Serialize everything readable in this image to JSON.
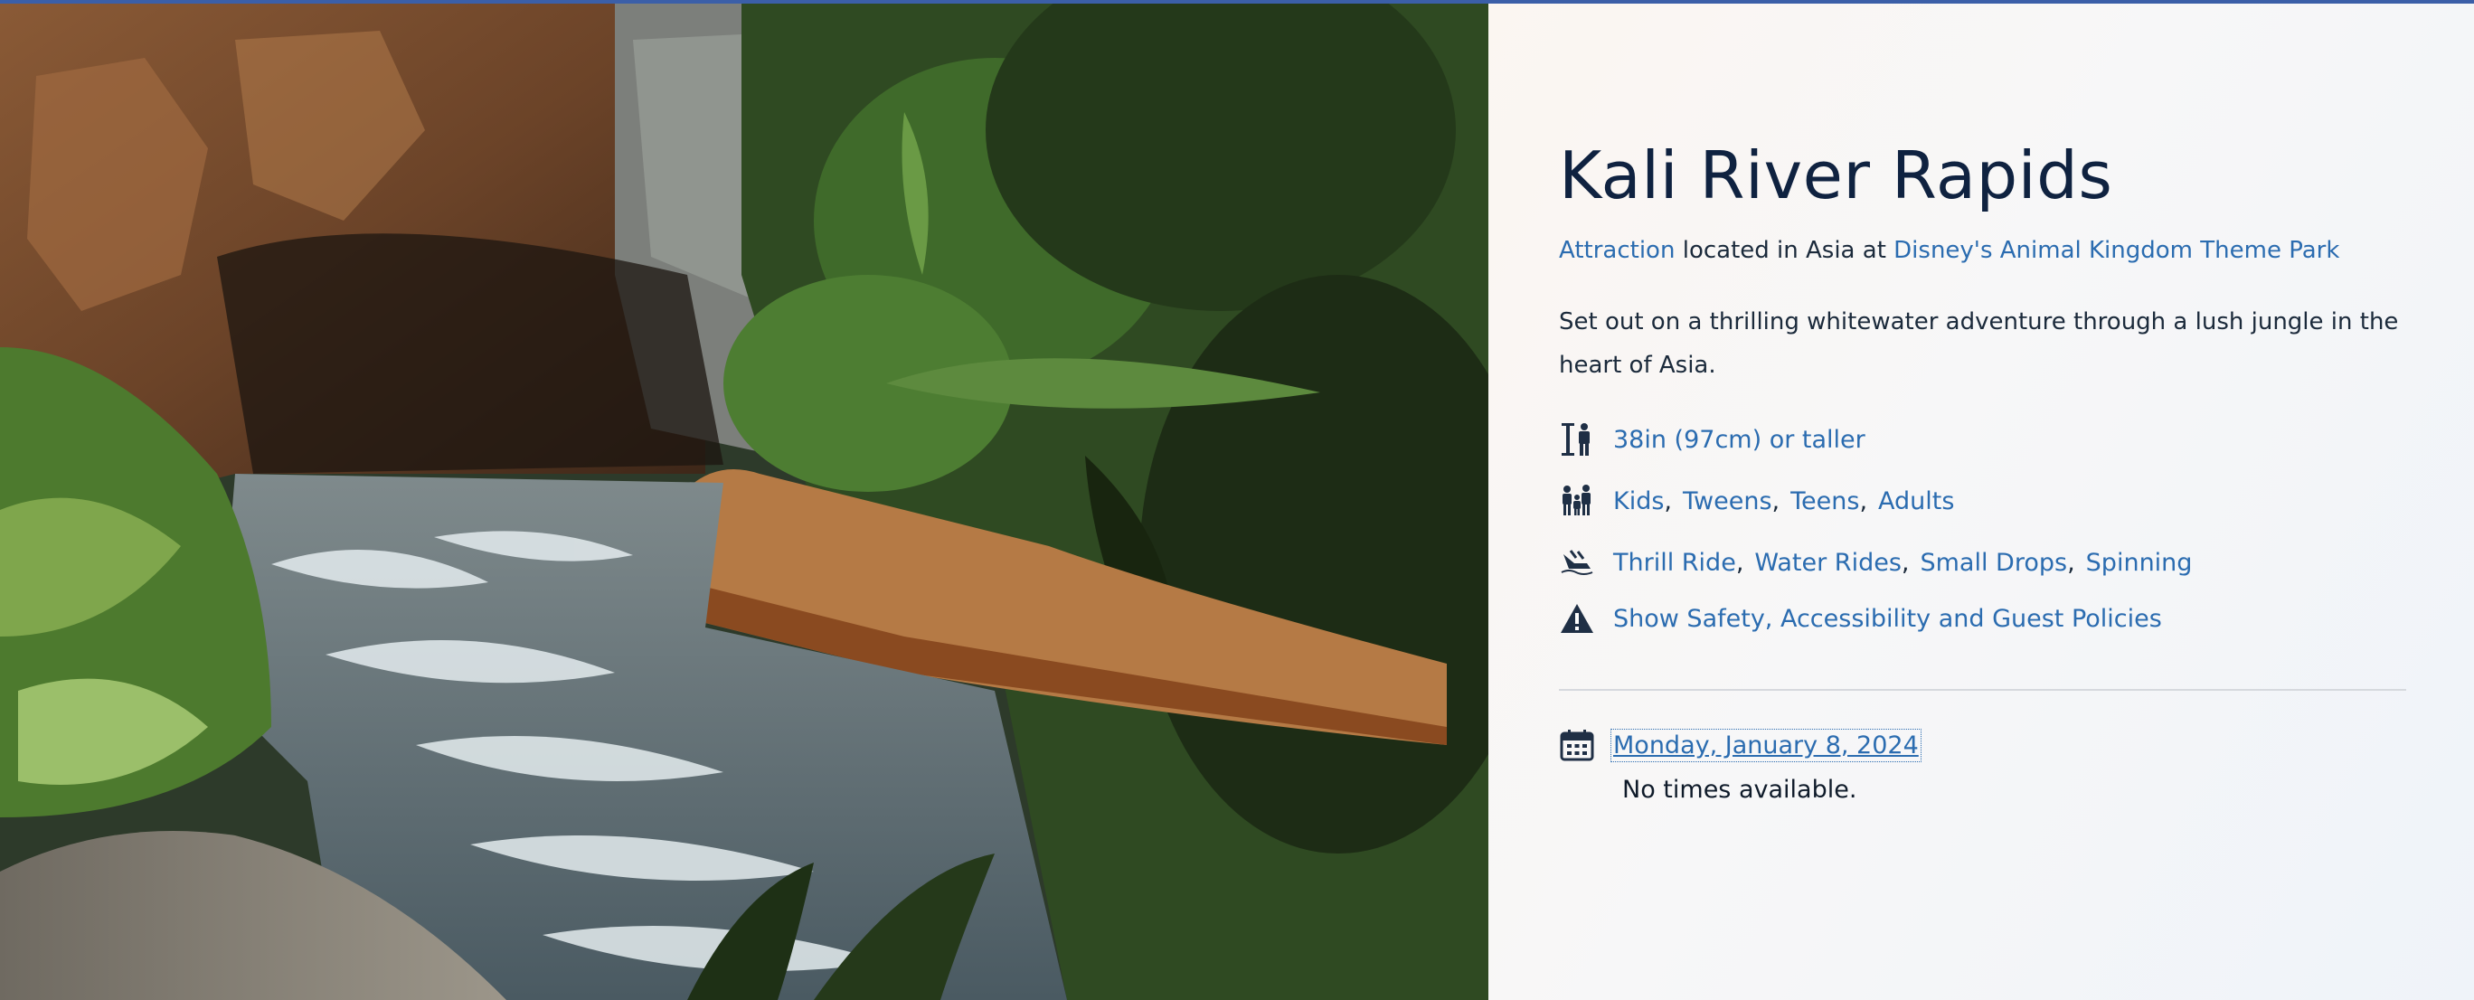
{
  "attraction": {
    "title": "Kali River Rapids",
    "type_link": "Attraction",
    "location_text": "located in Asia at",
    "park_link": "Disney's Animal Kingdom Theme Park",
    "description": "Set out on a thrilling whitewater adventure through a lush jungle in the heart of Asia.",
    "height_requirement": "38in (97cm) or taller",
    "ages": [
      "Kids",
      "Tweens",
      "Teens",
      "Adults"
    ],
    "categories": [
      "Thrill Ride",
      "Water Rides",
      "Small Drops",
      "Spinning"
    ],
    "policies_link": "Show Safety, Accessibility and Guest Policies"
  },
  "schedule": {
    "date_link": "Monday, January 8, 2024",
    "status": "No times available."
  },
  "icons": {
    "height": "height-requirement-icon",
    "ages": "family-icon",
    "category": "raft-ride-icon",
    "warning": "warning-icon",
    "calendar": "calendar-icon"
  },
  "colors": {
    "link": "#2b6cb0",
    "title": "#0f2240",
    "top_bar": "#3b5fa8"
  }
}
